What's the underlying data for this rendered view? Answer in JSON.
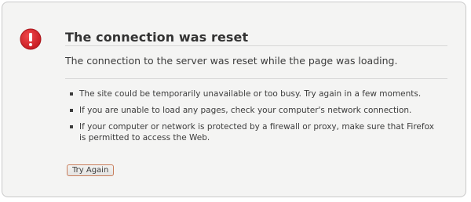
{
  "error_page": {
    "title": "The connection was reset",
    "short_description": "The connection to the server was reset while the page was loading.",
    "suggestions": [
      "The site could be temporarily unavailable or too busy. Try again in a few moments.",
      "If you are unable to load any pages, check your computer's network connection.",
      "If your computer or network is protected by a firewall or proxy, make sure that Firefox is permitted to access the Web."
    ],
    "try_again_label": "Try Again",
    "icon": "error-exclamation-icon"
  },
  "colors": {
    "icon_red": "#d8262c",
    "background": "#f4f4f3",
    "border": "#c9c9c9",
    "button_border": "#c97e5c"
  }
}
